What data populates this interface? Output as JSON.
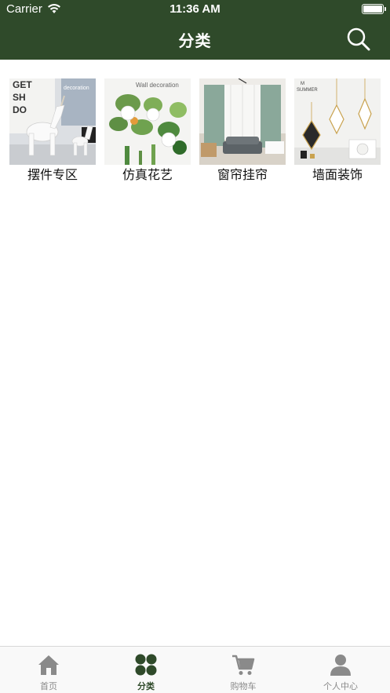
{
  "status_bar": {
    "carrier": "Carrier",
    "time": "11:36 AM"
  },
  "nav": {
    "title": "分类"
  },
  "theme": {
    "primary": "#2f4a2a",
    "tab_inactive": "#8a8a8a"
  },
  "categories": [
    {
      "label": "摆件专区",
      "image_text": "decoration",
      "image_subject": "unicorn-figurines"
    },
    {
      "label": "仿真花艺",
      "image_text": "Wall decoration",
      "image_subject": "hanging-succulent-planters"
    },
    {
      "label": "窗帘挂帘",
      "image_text": "",
      "image_subject": "living-room-curtains"
    },
    {
      "label": "墙面装饰",
      "image_text": "SUMMER",
      "image_subject": "gold-diamond-mirrors"
    }
  ],
  "tabbar": {
    "items": [
      {
        "label": "首页",
        "icon": "home-icon",
        "active": false
      },
      {
        "label": "分类",
        "icon": "grid-icon",
        "active": true
      },
      {
        "label": "购物车",
        "icon": "cart-icon",
        "active": false
      },
      {
        "label": "个人中心",
        "icon": "person-icon",
        "active": false
      }
    ]
  }
}
